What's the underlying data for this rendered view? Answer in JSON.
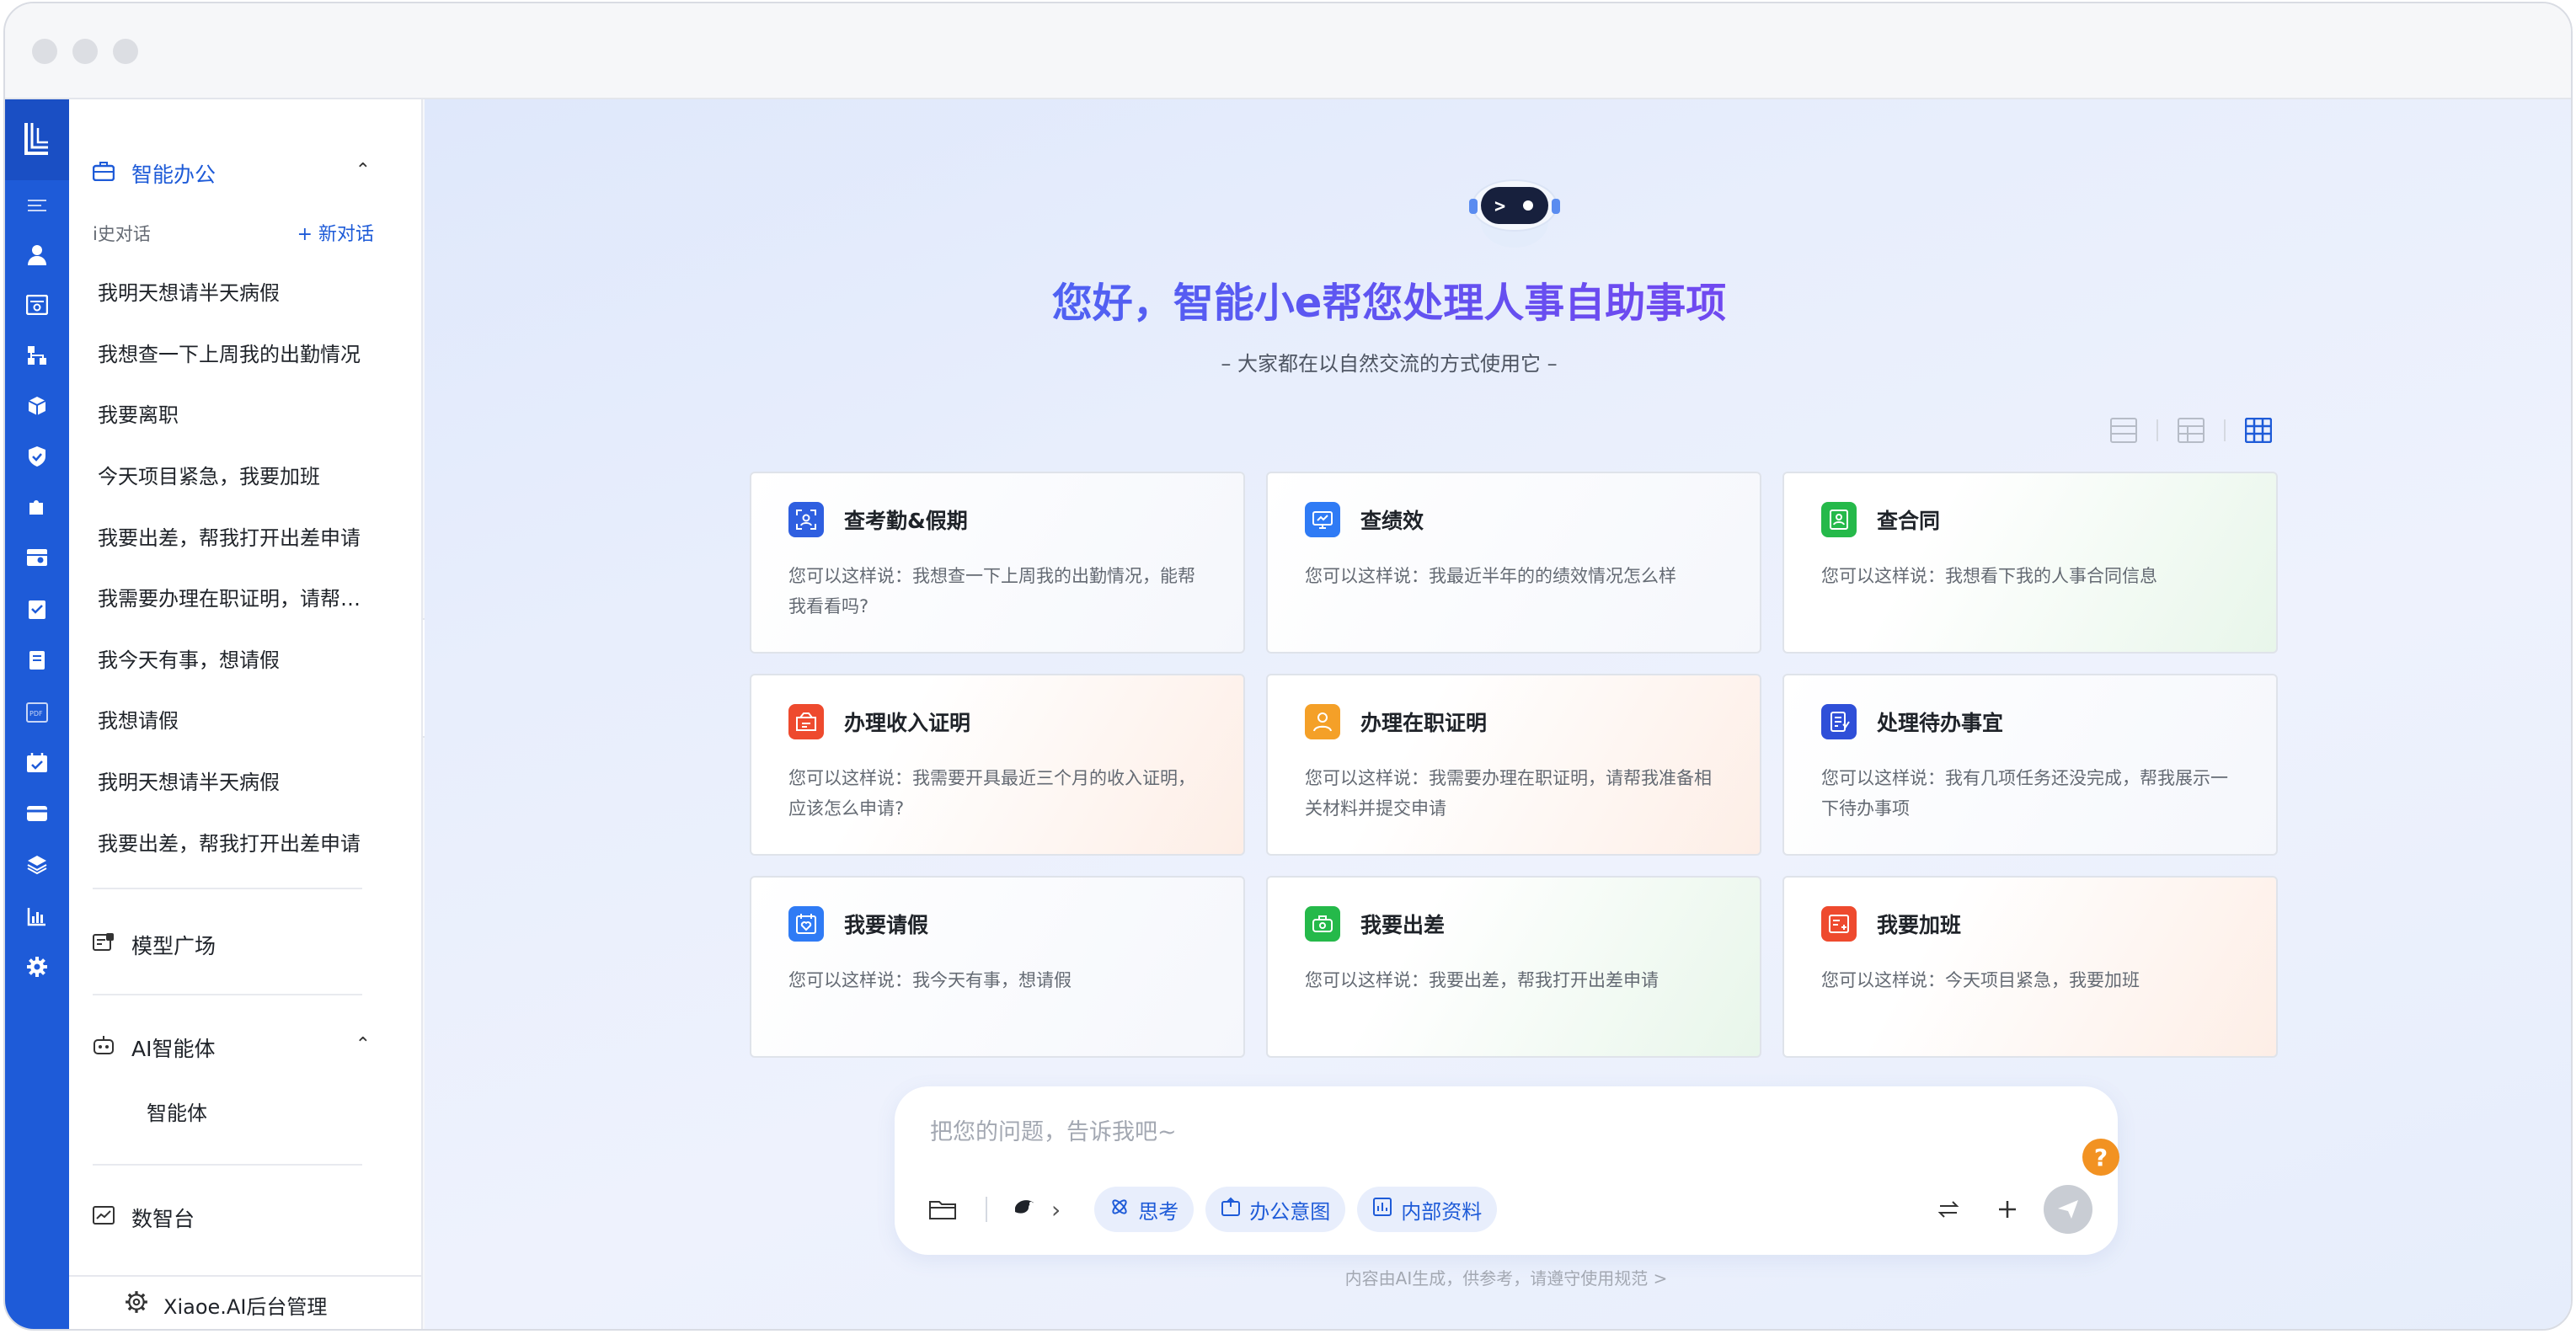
{
  "window": {
    "title": ""
  },
  "rail": {
    "icons": [
      "app-logo-icon",
      "menu-toggle-icon",
      "user-icon",
      "search-doc-icon",
      "org-chart-icon",
      "cube-icon",
      "shield-check-icon",
      "puzzle-icon",
      "settings-panel-icon",
      "task-check-icon",
      "book-icon",
      "pdf-icon",
      "calendar-icon",
      "card-icon",
      "layers-icon",
      "bar-chart-icon",
      "gear-icon"
    ]
  },
  "sidebar": {
    "smart_office": {
      "label": "智能办公"
    },
    "history_label": "i史对话",
    "new_chat": "+ 新对话",
    "history": [
      "我明天想请半天病假",
      "我想查一下上周我的出勤情况",
      "我要离职",
      "今天项目紧急，我要加班",
      "我要出差，帮我打开出差申请",
      "我需要办理在职证明，请帮我准备相关材料",
      "我今天有事，想请假",
      "我想请假",
      "我明天想请半天病假",
      "我要出差，帮我打开出差申请"
    ],
    "model_plaza": "模型广场",
    "ai_agent": {
      "label": "AI智能体",
      "items": [
        "智能体"
      ]
    },
    "data_platform": "数智台",
    "footer": "Xiaoe.AI后台管理"
  },
  "main": {
    "title": "您好，智能小e帮您处理人事自助事项",
    "subtitle": "– 大家都在以自然交流的方式使用它 –",
    "cards": [
      {
        "title": "查考勤&假期",
        "desc": "您可以这样说：我想查一下上周我的出勤情况，能帮我看看吗?",
        "icon": "attendance-icon",
        "color": "#2f5fe0"
      },
      {
        "title": "查绩效",
        "desc": "您可以这样说：我最近半年的的绩效情况怎么样",
        "icon": "performance-icon",
        "color": "#2f7bf5"
      },
      {
        "title": "查合同",
        "desc": "您可以这样说：我想看下我的人事合同信息",
        "icon": "contract-icon",
        "color": "#25b94a"
      },
      {
        "title": "办理收入证明",
        "desc": "您可以这样说：我需要开具最近三个月的收入证明，应该怎么申请?",
        "icon": "income-cert-icon",
        "color": "#ee4a2e"
      },
      {
        "title": "办理在职证明",
        "desc": "您可以这样说：我需要办理在职证明，请帮我准备相关材料并提交申请",
        "icon": "employment-cert-icon",
        "color": "#f4a028"
      },
      {
        "title": "处理待办事宜",
        "desc": "您可以这样说：我有几项任务还没完成，帮我展示一下待办事项",
        "icon": "todo-icon",
        "color": "#2f4fd8"
      },
      {
        "title": "我要请假",
        "desc": "您可以这样说：我今天有事，想请假",
        "icon": "leave-icon",
        "color": "#2f7bf5"
      },
      {
        "title": "我要出差",
        "desc": "您可以这样说：我要出差，帮我打开出差申请",
        "icon": "travel-icon",
        "color": "#25b94a"
      },
      {
        "title": "我要加班",
        "desc": "您可以这样说：今天项目紧急，我要加班",
        "icon": "overtime-icon",
        "color": "#ee4a2e"
      }
    ],
    "composer": {
      "placeholder": "把您的问题，告诉我吧~",
      "chips": [
        "思考",
        "办公意图",
        "内部资料"
      ]
    },
    "disclaimer": "内容由AI生成，供参考，请遵守使用规范 >"
  },
  "colors": {
    "primary": "#1e5bd8",
    "rail": "#1e5bd8",
    "help": "#f29222"
  }
}
